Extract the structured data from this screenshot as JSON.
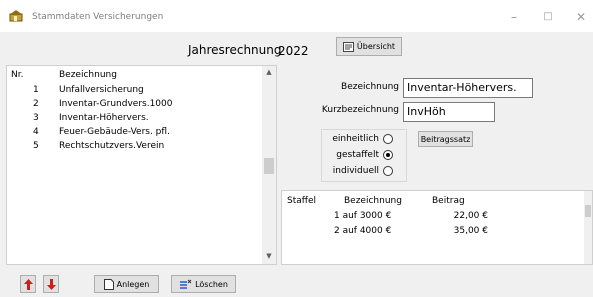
{
  "window": {
    "title": "Stammdaten Versicherungen"
  },
  "header": {
    "caption": "Jahresrechnung",
    "year": "2022",
    "overview_label": "Übersicht"
  },
  "list": {
    "col_nr": "Nr.",
    "col_bez": "Bezeichnung",
    "rows": [
      {
        "nr": "1",
        "bez": "Unfallversicherung"
      },
      {
        "nr": "2",
        "bez": "Inventar-Grundvers.1000"
      },
      {
        "nr": "3",
        "bez": "Inventar-Höhervers."
      },
      {
        "nr": "4",
        "bez": "Feuer-Gebäude-Vers. pfl."
      },
      {
        "nr": "5",
        "bez": "Rechtschutzvers.Verein"
      }
    ]
  },
  "form": {
    "bez_label": "Bezeichnung",
    "bez_value": "Inventar-Höhervers.",
    "kurz_label": "Kurzbezeichnung",
    "kurz_value": "InvHöh",
    "radios": [
      {
        "label": "einheitlich",
        "checked": false
      },
      {
        "label": "gestaffelt",
        "checked": true
      },
      {
        "label": "individuell",
        "checked": false
      }
    ],
    "rate_button": "Beitragssatz"
  },
  "staffel": {
    "col_staffel": "Staffel",
    "col_bez": "Bezeichnung",
    "col_beitrag": "Beitrag",
    "rows": [
      {
        "bez": "1 auf 3000 €",
        "beitrag": "22,00 €"
      },
      {
        "bez": "2 auf 4000 €",
        "beitrag": "35,00 €"
      }
    ]
  },
  "buttons": {
    "create": "Anlegen",
    "delete": "Löschen"
  },
  "colors": {
    "arrow_red": "#d41a1a"
  }
}
